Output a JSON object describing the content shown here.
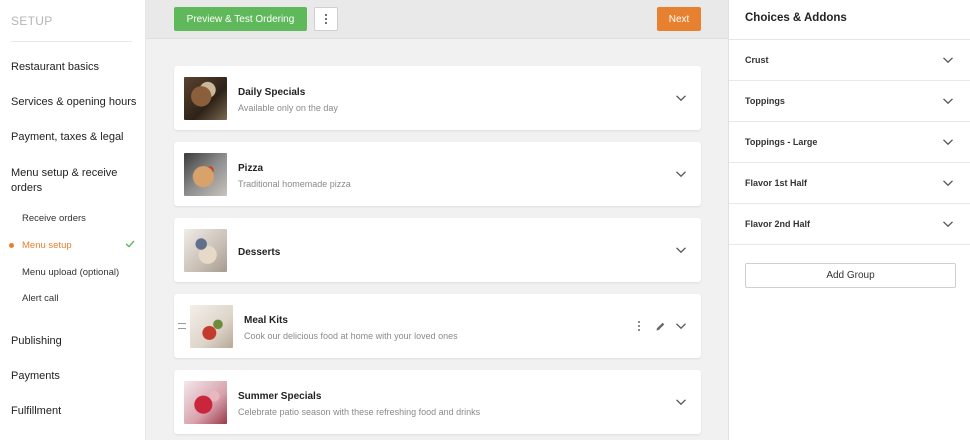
{
  "sidebar": {
    "title": "SETUP",
    "items": [
      {
        "label": "Restaurant basics"
      },
      {
        "label": "Services & opening hours"
      },
      {
        "label": "Payment, taxes & legal"
      },
      {
        "label": "Menu setup & receive orders"
      }
    ],
    "subitems": [
      {
        "label": "Receive orders"
      },
      {
        "label": "Menu setup"
      },
      {
        "label": "Menu upload (optional)"
      },
      {
        "label": "Alert call"
      }
    ],
    "bottom_items": [
      {
        "label": "Publishing"
      },
      {
        "label": "Payments"
      },
      {
        "label": "Fulfillment"
      }
    ]
  },
  "toolbar": {
    "preview_label": "Preview & Test Ordering",
    "next_label": "Next"
  },
  "categories": [
    {
      "title": "Daily Specials",
      "description": "Available only on the day"
    },
    {
      "title": "Pizza",
      "description": "Traditional homemade pizza"
    },
    {
      "title": "Desserts",
      "description": ""
    },
    {
      "title": "Meal Kits",
      "description": "Cook our delicious food at home with your loved ones"
    },
    {
      "title": "Summer Specials",
      "description": "Celebrate patio season with these refreshing food and drinks"
    }
  ],
  "addons": {
    "title": "Choices & Addons",
    "groups": [
      {
        "label": "Crust"
      },
      {
        "label": "Toppings"
      },
      {
        "label": "Toppings - Large"
      },
      {
        "label": "Flavor 1st Half"
      },
      {
        "label": "Flavor 2nd Half"
      }
    ],
    "add_group_label": "Add Group"
  },
  "colors": {
    "primary_green": "#5fb95a",
    "accent_orange": "#e8812f"
  }
}
